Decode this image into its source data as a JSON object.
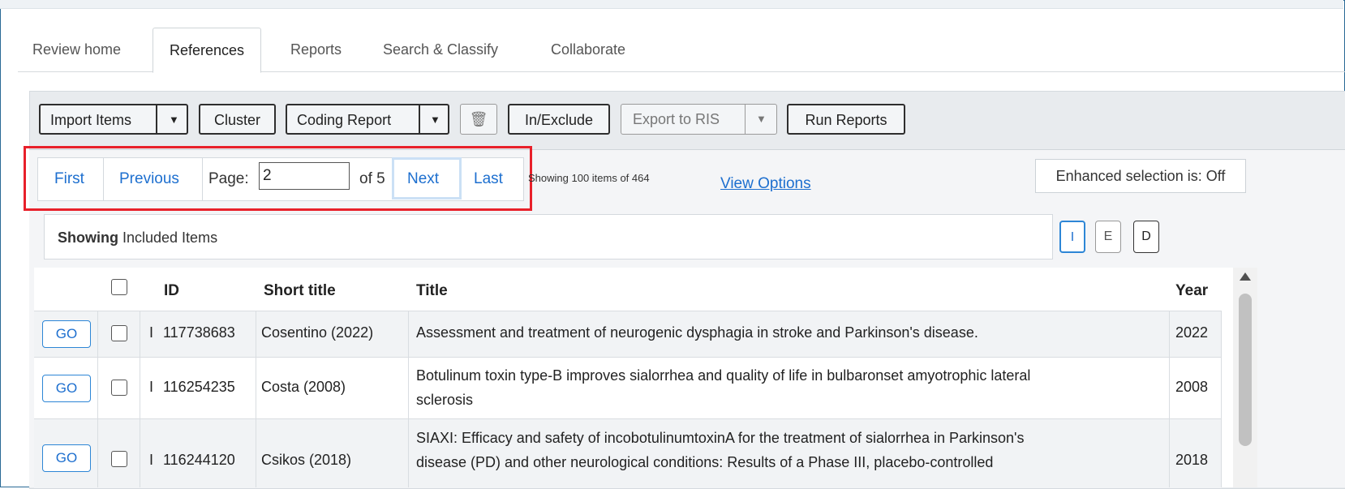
{
  "tabs": [
    {
      "label": "Review home",
      "active": false
    },
    {
      "label": "References",
      "active": true
    },
    {
      "label": "Reports",
      "active": false
    },
    {
      "label": "Search & Classify",
      "active": false
    },
    {
      "label": "Collaborate",
      "active": false
    }
  ],
  "toolbar": {
    "import_items": "Import Items",
    "cluster": "Cluster",
    "coding_report": "Coding Report",
    "in_exclude": "In/Exclude",
    "export_ris": "Export to RIS",
    "run_reports": "Run Reports",
    "dropdown_arrow": "▼",
    "trash_icon": "🗑"
  },
  "pager": {
    "first": "First",
    "previous": "Previous",
    "page_label": "Page:",
    "page_value": "2",
    "of_label": "of 5",
    "next": "Next",
    "last": "Last",
    "showing_count": "Showing 100 items of 464",
    "view_options": "View Options"
  },
  "enhanced_selection": "Enhanced selection is: Off",
  "filter": {
    "showing_bold": "Showing",
    "showing_rest": " Included Items",
    "buttons": [
      "I",
      "E",
      "D"
    ],
    "active": "I"
  },
  "table": {
    "headers": {
      "id": "ID",
      "short_title": "Short title",
      "title": "Title",
      "year": "Year"
    },
    "rows": [
      {
        "go": "GO",
        "flag": "I",
        "id": "117738683",
        "short_title": "Cosentino (2022)",
        "title_lines": [
          "Assessment and treatment of neurogenic dysphagia in stroke and Parkinson's disease."
        ],
        "year": "2022"
      },
      {
        "go": "GO",
        "flag": "I",
        "id": "116254235",
        "short_title": "Costa (2008)",
        "title_lines": [
          "Botulinum toxin type-B improves sialorrhea and quality of life in bulbaronset amyotrophic lateral",
          "sclerosis"
        ],
        "year": "2008"
      },
      {
        "go": "GO",
        "flag": "I",
        "id": "116244120",
        "short_title": "Csikos (2018)",
        "title_lines": [
          "SIAXI: Efficacy and safety of incobotulinumtoxinA for the treatment of sialorrhea in Parkinson's",
          "disease (PD) and other neurological conditions: Results of a Phase III, placebo-controlled"
        ],
        "year": "2018"
      }
    ]
  },
  "colors": {
    "link": "#1d6fcf",
    "highlight": "#e8202a",
    "frame": "#2a6a96"
  }
}
